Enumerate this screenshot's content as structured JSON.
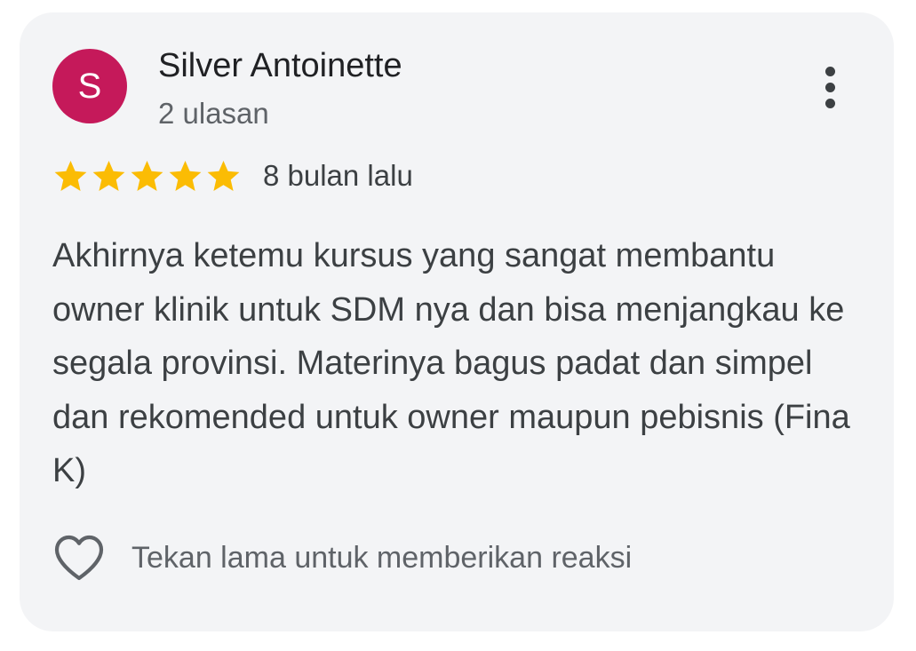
{
  "review": {
    "author": {
      "initial": "S",
      "name": "Silver Antoinette",
      "review_count": "2 ulasan",
      "avatar_color": "#c5195a"
    },
    "menu_icon": "more-vertical-icon",
    "rating": 5,
    "max_rating": 5,
    "star_color": "#fbbc04",
    "date": "8 bulan lalu",
    "text": "Akhirnya ketemu kursus yang sangat membantu owner klinik untuk SDM nya dan bisa menjangkau ke segala provinsi. Materinya bagus padat dan simpel dan rekomended untuk owner maupun pebisnis (Fina K)",
    "reaction": {
      "icon": "heart-icon",
      "hint": "Tekan lama untuk memberikan reaksi"
    }
  }
}
